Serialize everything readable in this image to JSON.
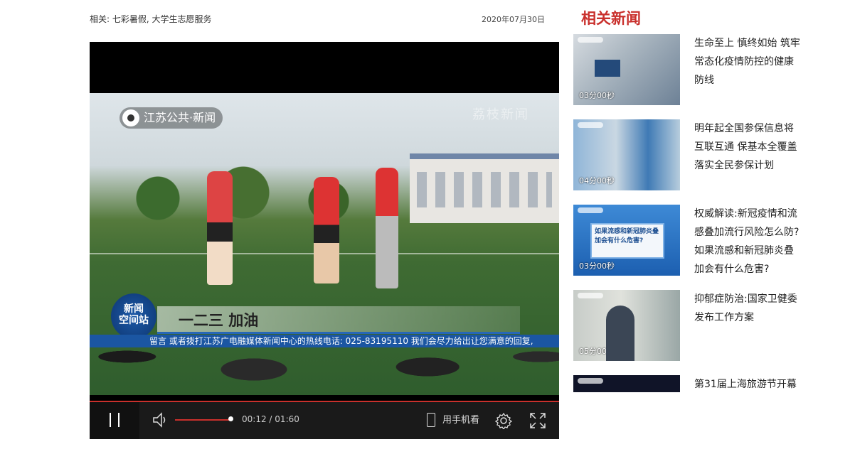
{
  "meta": {
    "related_label": "相关: 七彩暑假, 大学生志愿服务",
    "date": "2020年07月30日"
  },
  "video": {
    "logo_text": "江苏公共·新闻",
    "corner_mark": "荔枝新闻",
    "badge_text": "新闻\n空间站",
    "caption": "一二三 加油",
    "ticker": "留言  或者拨打江苏广电融媒体新闻中心的热线电话: 025-83195110    我们会尽力给出让您满意的回复,"
  },
  "controls": {
    "current_time": "00:12",
    "separator": "/",
    "duration": "01:60",
    "mobile_label": "用手机看",
    "volume_level": 0.95
  },
  "sidebar": {
    "title": "相关新闻",
    "items": [
      {
        "title": "生命至上 慎终如始 筑牢常态化疫情防控的健康防线",
        "duration": "03分00秒"
      },
      {
        "title": "明年起全国参保信息将互联互通 保基本全覆盖落实全民参保计划",
        "duration": "04分00秒"
      },
      {
        "title": "权威解读:新冠疫情和流感叠加流行风险怎么防? 如果流感和新冠肺炎叠加会有什么危害?",
        "duration": "03分00秒",
        "panel_text": "如果流感和新冠肺炎叠加会有什么危害?"
      },
      {
        "title": "抑郁症防治:国家卫健委发布工作方案",
        "duration": "05分00秒"
      },
      {
        "title": "第31届上海旅游节开幕",
        "duration": ""
      }
    ]
  }
}
